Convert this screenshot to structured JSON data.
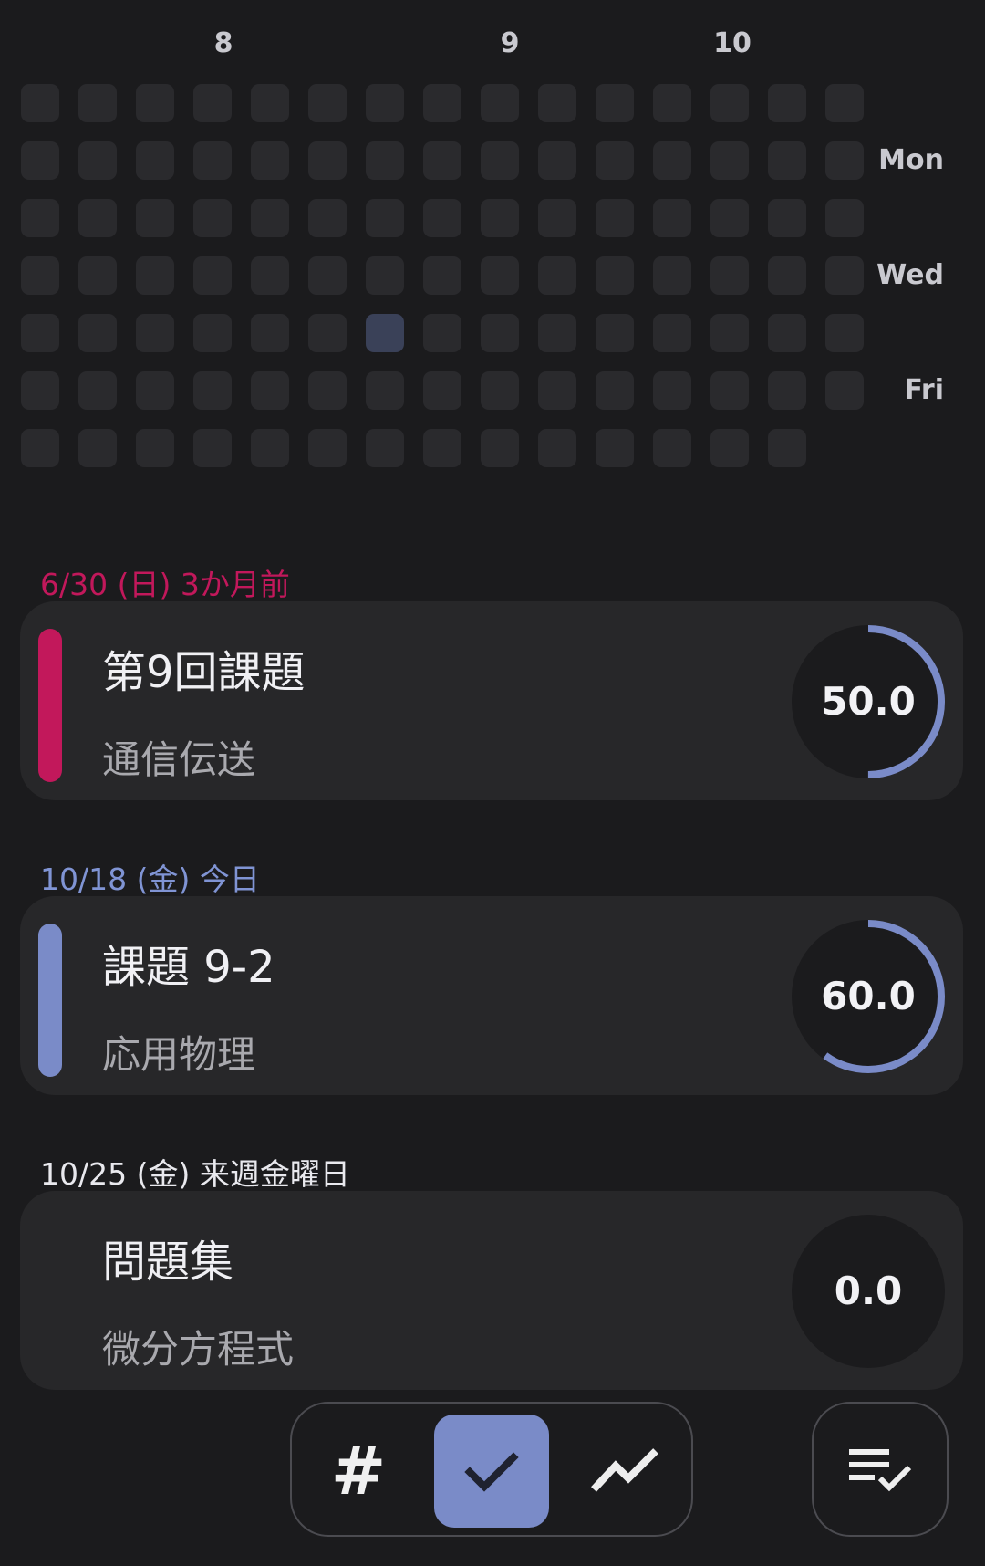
{
  "heatmap": {
    "months": [
      "8",
      "9",
      "10"
    ],
    "day_labels": [
      "Mon",
      "Wed",
      "Fri"
    ],
    "colors": {
      "empty": "#2a2a2d",
      "highlight": "#3a4158"
    }
  },
  "groups": [
    {
      "date": "6/30 (日) 3か月前",
      "date_color": "#c2185b",
      "card": {
        "title": "第9回課題",
        "subject": "通信伝送",
        "score": "50.0",
        "progress": 0.5,
        "accent": "#c2185b"
      }
    },
    {
      "date": "10/18 (金) 今日",
      "date_color": "#8094d4",
      "card": {
        "title": "課題 9-2",
        "subject": "応用物理",
        "score": "60.0",
        "progress": 0.6,
        "accent": "#7a8bc8"
      }
    },
    {
      "date": "10/25 (金) 来週金曜日",
      "date_color": "#e9e9ee",
      "card": {
        "title": "問題集",
        "subject": "微分方程式",
        "score": "0.0",
        "progress": 0.0,
        "accent": null
      }
    }
  ],
  "nav": {
    "items": [
      {
        "icon": "hash-icon",
        "label": "#",
        "active": false
      },
      {
        "icon": "check-icon",
        "active": true
      },
      {
        "icon": "trend-icon",
        "active": false
      }
    ],
    "fab_icon": "checklist-icon",
    "active_color": "#7a8bc8"
  }
}
